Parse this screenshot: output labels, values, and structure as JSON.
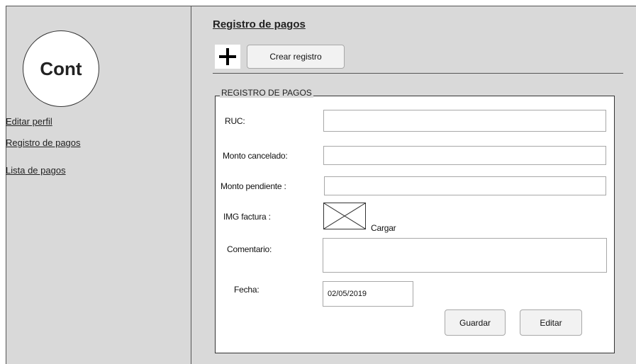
{
  "sidebar": {
    "logo_text": "Cont",
    "links": [
      "Editar perfil",
      "Registro de pagos",
      "Lista de pagos"
    ]
  },
  "main": {
    "title": "Registro de pagos",
    "create_button": "Crear registro",
    "form": {
      "legend": "REGISTRO DE PAGOS",
      "ruc_label": "RUC:",
      "ruc_value": "",
      "monto_cancelado_label": "Monto cancelado:",
      "monto_cancelado_value": "",
      "monto_pendiente_label": "Monto pendiente  :",
      "monto_pendiente_value": "",
      "img_label": "IMG factura :",
      "cargar_label": "Cargar",
      "comentario_label": "Comentario:",
      "comentario_value": "",
      "fecha_label": "Fecha:",
      "fecha_value": "02/05/2019",
      "guardar_label": "Guardar",
      "editar_label": "Editar"
    }
  },
  "icons": {
    "add": "plus-icon",
    "image_placeholder": "image-placeholder-icon"
  }
}
